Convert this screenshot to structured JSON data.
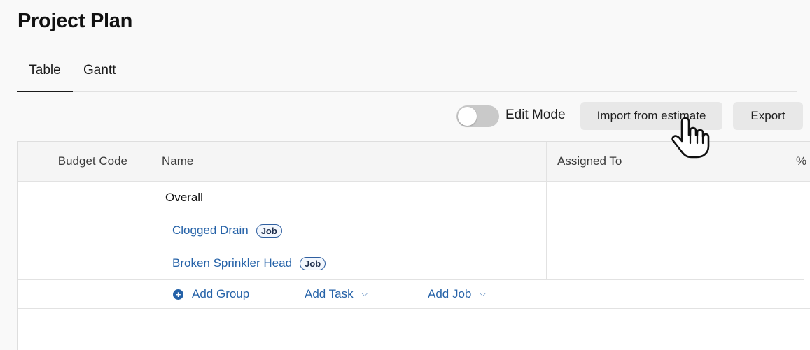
{
  "page": {
    "title": "Project Plan"
  },
  "tabs": [
    {
      "label": "Table",
      "active": true
    },
    {
      "label": "Gantt",
      "active": false
    }
  ],
  "toolbar": {
    "edit_mode_label": "Edit Mode",
    "edit_mode_on": false,
    "import_label": "Import from estimate",
    "export_label": "Export"
  },
  "table": {
    "columns": [
      "Budget Code",
      "Name",
      "Assigned To",
      "%"
    ],
    "rows": [
      {
        "budget_code": "",
        "name": "Overall",
        "badge": "",
        "assigned_to": ""
      },
      {
        "budget_code": "",
        "name": "Clogged Drain",
        "badge": "Job",
        "assigned_to": ""
      },
      {
        "budget_code": "",
        "name": "Broken Sprinkler Head",
        "badge": "Job",
        "assigned_to": ""
      }
    ],
    "actions": {
      "add_group": "Add Group",
      "add_task": "Add Task",
      "add_job": "Add Job"
    }
  },
  "colors": {
    "link": "#2562a8",
    "toggle_off": "#c9c9c9"
  },
  "icons": {
    "add_group": "plus-circle-icon",
    "dropdown": "chevron-down-icon",
    "cursor": "hand-pointer-icon"
  }
}
